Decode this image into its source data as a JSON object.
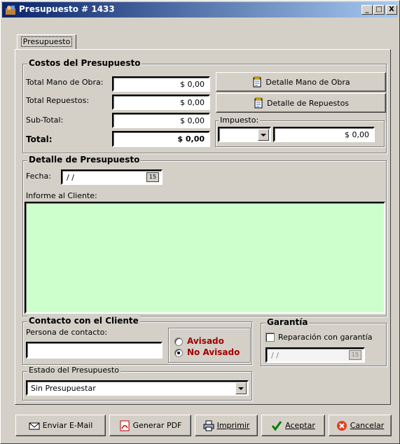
{
  "window": {
    "title": "Presupuesto # 1433",
    "minimize": "_",
    "maximize": "□",
    "close": "X"
  },
  "tab": {
    "label": "Presupuesto"
  },
  "costos": {
    "title": "Costos del Presupuesto",
    "mano_obra_label": "Total Mano de Obra:",
    "mano_obra_value": "$ 0,00",
    "repuestos_label": "Total Repuestos:",
    "repuestos_value": "$ 0,00",
    "subtotal_label": "Sub-Total:",
    "subtotal_value": "$ 0,00",
    "total_label": "Total:",
    "total_value": "$ 0,00",
    "detalle_mano_obra_btn": "Detalle Mano de Obra",
    "detalle_repuestos_btn": "Detalle de Repuestos",
    "impuesto_title": "Impuesto:",
    "impuesto_select": "",
    "impuesto_value": "$ 0,00"
  },
  "detalle": {
    "title": "Detalle de Presupuesto",
    "fecha_label": "Fecha:",
    "fecha_value": "/ /",
    "cal_icon": "15",
    "informe_label": "Informe al Cliente:",
    "informe_value": "",
    "informe_bg": "#ccffcc"
  },
  "contacto": {
    "title": "Contacto con el Cliente",
    "persona_label": "Persona de contacto:",
    "persona_value": "",
    "avisado": "Avisado",
    "no_avisado": "No Avisado",
    "selected": "No Avisado",
    "radio_color": "#a00000"
  },
  "garantia": {
    "title": "Garantía",
    "checkbox_label": "Reparación con garantía",
    "checked": false,
    "fecha_value": "/ /",
    "cal_icon": "15"
  },
  "estado": {
    "title": "Estado del Presupuesto",
    "value": "Sin Presupuestar"
  },
  "footer": {
    "email_btn": "Enviar E-Mail",
    "pdf_btn": "Generar PDF",
    "imprimir_btn": "Imprimir",
    "aceptar_btn": "Aceptar",
    "cancelar_btn": "Cancelar"
  }
}
